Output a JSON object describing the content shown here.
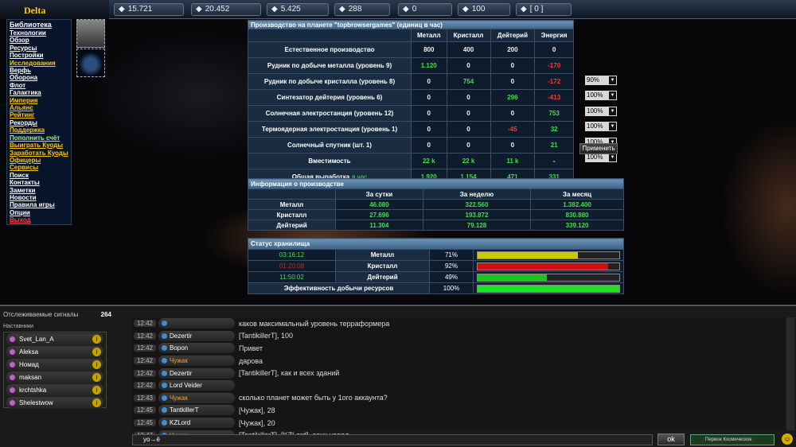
{
  "app": {
    "logo": "Delta"
  },
  "resources": [
    {
      "icon": "metal-icon",
      "value": "15.721"
    },
    {
      "icon": "crystal-icon",
      "value": "20.452"
    },
    {
      "icon": "deuterium-icon",
      "value": "5.425"
    },
    {
      "icon": "energy-icon",
      "value": "288"
    },
    {
      "icon": "coin-icon",
      "value": "0"
    },
    {
      "icon": "darkmatter-icon",
      "value": "100"
    },
    {
      "icon": "mail-icon",
      "value": "[ 0 ]"
    }
  ],
  "sidebar": {
    "items": [
      "Библиотека",
      "Технологии",
      "Обзор",
      "Ресурсы",
      "Постройки",
      "Исследования",
      "Верфь",
      "Оборона",
      "Флот",
      "Галактика",
      "Империя",
      "Альянс",
      "Рейтинг",
      "Рекорды",
      "Поддержка",
      "Пополнить счёт",
      "Выиграть Куоды",
      "Заработать Куоды",
      "Офицеры",
      "Сервисы",
      "Поиск",
      "Контакты",
      "Заметки",
      "Новости",
      "Правила игры",
      "Опции",
      "Выход"
    ]
  },
  "production": {
    "title": "Производство на планете \"topbrowsergames\" (единиц в час)",
    "columns": [
      "",
      "Металл",
      "Кристалл",
      "Дейтерий",
      "Энергия"
    ],
    "rows": [
      {
        "label": "Естественное производство",
        "vals": [
          "800",
          "400",
          "200",
          "0"
        ],
        "cls": [
          "gr",
          "gr",
          "gr",
          "gr"
        ],
        "pct": ""
      },
      {
        "label": "Рудник по добыче металла (уровень 9)",
        "vals": [
          "1.120",
          "0",
          "0",
          "-170"
        ],
        "cls": [
          "g",
          "gr",
          "gr",
          "r"
        ],
        "pct": "90%"
      },
      {
        "label": "Рудник по добыче кристалла (уровень 8)",
        "vals": [
          "0",
          "754",
          "0",
          "-172"
        ],
        "cls": [
          "gr",
          "g",
          "gr",
          "r"
        ],
        "pct": "100%"
      },
      {
        "label": "Синтезатор дейтерия (уровень 6)",
        "vals": [
          "0",
          "0",
          "296",
          "-413"
        ],
        "cls": [
          "gr",
          "gr",
          "g",
          "r"
        ],
        "pct": "100%"
      },
      {
        "label": "Солнечная электростанция (уровень 12)",
        "vals": [
          "0",
          "0",
          "0",
          "753"
        ],
        "cls": [
          "gr",
          "gr",
          "gr",
          "g"
        ],
        "pct": "100%"
      },
      {
        "label": "Термоядерная электростанция (уровень 1)",
        "vals": [
          "0",
          "0",
          "-45",
          "32"
        ],
        "cls": [
          "gr",
          "gr",
          "r",
          "g"
        ],
        "pct": "100%"
      },
      {
        "label": "Солнечный спутник (шт. 1)",
        "vals": [
          "0",
          "0",
          "0",
          "21"
        ],
        "cls": [
          "gr",
          "gr",
          "gr",
          "g"
        ],
        "pct": "100%"
      },
      {
        "label": "Вместимость",
        "vals": [
          "22 k",
          "22 k",
          "11 k",
          "-"
        ],
        "cls": [
          "g",
          "g",
          "g",
          "gr"
        ],
        "pct": ""
      },
      {
        "label": "Общая выработка",
        "label_suffix": "в час",
        "vals": [
          "1.920",
          "1.154",
          "471",
          "331"
        ],
        "cls": [
          "g",
          "g",
          "g",
          "g"
        ],
        "pct": ""
      }
    ],
    "apply": "Применить"
  },
  "info": {
    "title": "Информация о производстве",
    "columns": [
      "",
      "За сутки",
      "За неделю",
      "За месяц"
    ],
    "rows": [
      {
        "label": "Металл",
        "vals": [
          "46.080",
          "322.560",
          "1.382.400"
        ]
      },
      {
        "label": "Кристалл",
        "vals": [
          "27.696",
          "193.872",
          "830.880"
        ]
      },
      {
        "label": "Дейтерий",
        "vals": [
          "11.304",
          "79.128",
          "339.120"
        ]
      }
    ]
  },
  "storage": {
    "title": "Статус хранилища",
    "rows": [
      {
        "time": "03:16:12",
        "time_color": "#3ce04a",
        "label": "Металл",
        "pct": "71%",
        "fill": 0.71,
        "color": "#c9c900"
      },
      {
        "time": "01:20:08",
        "time_color": "#d0201a",
        "label": "Кристалл",
        "pct": "92%",
        "fill": 0.92,
        "color": "#cc1010"
      },
      {
        "time": "11:50:02",
        "time_color": "#3ce04a",
        "label": "Дейтерий",
        "pct": "49%",
        "fill": 0.49,
        "color": "#20c020"
      }
    ],
    "eff_label": "Эффективность добычи ресурсов",
    "eff_pct": "100%",
    "eff_fill": 1.0
  },
  "chat": {
    "signals_label": "Отслеживаемые сигналы",
    "signals_count": "264",
    "nav_label": "Наставники",
    "mentors": [
      "Svet_Lan_A",
      "Aleksa",
      "Номад",
      "maksan",
      "krchtshka",
      "Shelestwow"
    ],
    "messages": [
      {
        "time": "12:42",
        "nick": "",
        "text": "каков максимальный уровень терраформера",
        "o": false
      },
      {
        "time": "12:42",
        "nick": "Dezertir",
        "text": "[TantikillerT], 100",
        "o": false
      },
      {
        "time": "12:42",
        "nick": "Bopon",
        "text": "Привет",
        "o": false
      },
      {
        "time": "12:42",
        "nick": "Чужак",
        "text": "дарова",
        "o": true
      },
      {
        "time": "12:42",
        "nick": "Dezertir",
        "text": "[TantikillerT], как и всех зданий",
        "o": false
      },
      {
        "time": "12:42",
        "nick": "Lord Veider",
        "text": "",
        "o": false
      },
      {
        "time": "12:43",
        "nick": "Чужак",
        "text": "сколько планет может быть у 1ого аккаунта?",
        "o": true
      },
      {
        "time": "12:45",
        "nick": "TantkillerT",
        "text": "[Чужак], 28",
        "o": false
      },
      {
        "time": "12:45",
        "nick": "KZLord",
        "text": "[Чужак], 20",
        "o": false
      },
      {
        "time": "12:47",
        "nick": "Чужак",
        "text": "[TantikillerT], [KZLord], сенк народ",
        "o": true
      }
    ],
    "input_prefix": "yo→ё",
    "ok": "ok",
    "channel": "Первое Космическое",
    "smile": "☺"
  }
}
